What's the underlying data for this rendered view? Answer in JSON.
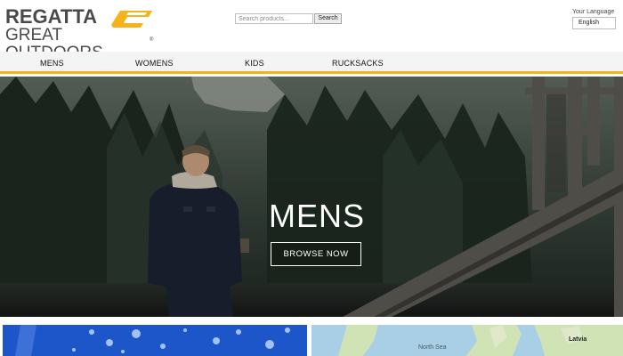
{
  "brand": {
    "line1": "REGATTA",
    "line2": "GREAT OUTDOORS",
    "trademark": "®",
    "accent": "#f5b21a",
    "text_color": "#4a4a4a"
  },
  "search": {
    "placeholder": "Search products...",
    "button_label": "Search"
  },
  "language": {
    "label": "Your Language",
    "selected": "English"
  },
  "nav": {
    "items": [
      "MENS",
      "WOMENS",
      "KIDS",
      "RUCKSACKS"
    ],
    "underline_color": "#f5b21a"
  },
  "hero": {
    "title": "MENS",
    "cta_label": "BROWSE NOW"
  },
  "tiles": {
    "left": {
      "color": "#1c56c8"
    },
    "right": {
      "sea_label": "North Sea",
      "country_label": "Latvia"
    }
  }
}
